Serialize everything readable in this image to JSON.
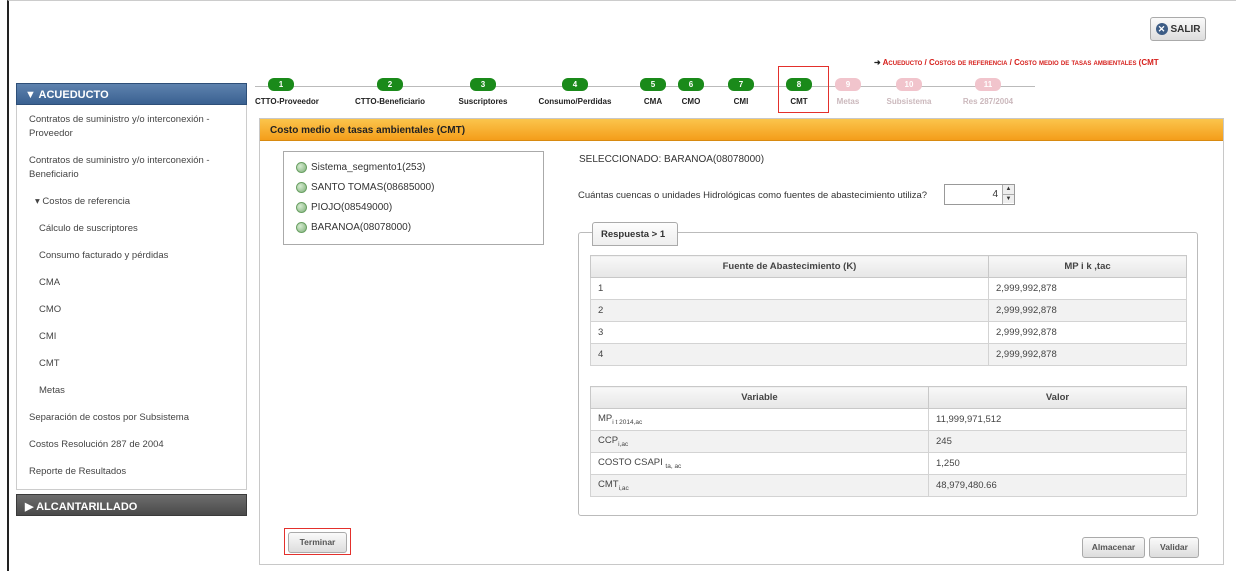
{
  "header": {
    "exit_label": "SALIR",
    "breadcrumb": "Acueducto / Costos de referencia / Costo medio de tasas ambientales (CMT"
  },
  "sidebar": {
    "section1": "ACUEDUCTO",
    "items": [
      "Contratos de suministro y/o interconexión - Proveedor",
      "Contratos de suministro y/o interconexión - Beneficiario",
      "Costos de referencia",
      "Cálculo de suscriptores",
      "Consumo facturado y pérdidas",
      "CMA",
      "CMO",
      "CMI",
      "CMT",
      "Metas",
      "Separación de costos por Subsistema",
      "Costos Resolución 287 de 2004",
      "Reporte de Resultados"
    ],
    "section2": "ALCANTARILLADO"
  },
  "tabs": [
    {
      "num": "1",
      "label": "CTTO-Proveedor"
    },
    {
      "num": "2",
      "label": "CTTO-Beneficiario"
    },
    {
      "num": "3",
      "label": "Suscriptores"
    },
    {
      "num": "4",
      "label": "Consumo/Perdidas"
    },
    {
      "num": "5",
      "label": "CMA"
    },
    {
      "num": "6",
      "label": "CMO"
    },
    {
      "num": "7",
      "label": "CMI"
    },
    {
      "num": "8",
      "label": "CMT"
    },
    {
      "num": "9",
      "label": "Metas"
    },
    {
      "num": "10",
      "label": "Subsistema"
    },
    {
      "num": "11",
      "label": "Res 287/2004"
    }
  ],
  "panel": {
    "title": "Costo medio de tasas ambientales (CMT)",
    "tree": [
      "Sistema_segmento1(253)",
      "SANTO TOMAS(08685000)",
      "PIOJO(08549000)",
      "BARANOA(08078000)"
    ],
    "selected": "SELECCIONADO: BARANOA(08078000)",
    "question": "Cuántas cuencas o unidades Hidrológicas como fuentes de abastecimiento utiliza?",
    "count_value": "4",
    "legend": "Respuesta > 1",
    "table1": {
      "headers": [
        "Fuente de Abastecimiento (K)",
        "MP i k ,tac"
      ],
      "rows": [
        [
          "1",
          "2,999,992,878"
        ],
        [
          "2",
          "2,999,992,878"
        ],
        [
          "3",
          "2,999,992,878"
        ],
        [
          "4",
          "2,999,992,878"
        ]
      ]
    },
    "table2": {
      "headers": [
        "Variable",
        "Valor"
      ],
      "rows": [
        {
          "var": "MP",
          "sub": "i t 2014,ac",
          "val": "11,999,971,512"
        },
        {
          "var": "CCP",
          "sub": "i,ac",
          "val": "245"
        },
        {
          "var": "COSTO CSAPI",
          "sub": "ta, ac",
          "val": "1,250"
        },
        {
          "var": "CMT",
          "sub": "i,ac",
          "val": "48,979,480.66"
        }
      ]
    },
    "buttons": {
      "terminar": "Terminar",
      "almacenar": "Almacenar",
      "validar": "Validar"
    }
  }
}
